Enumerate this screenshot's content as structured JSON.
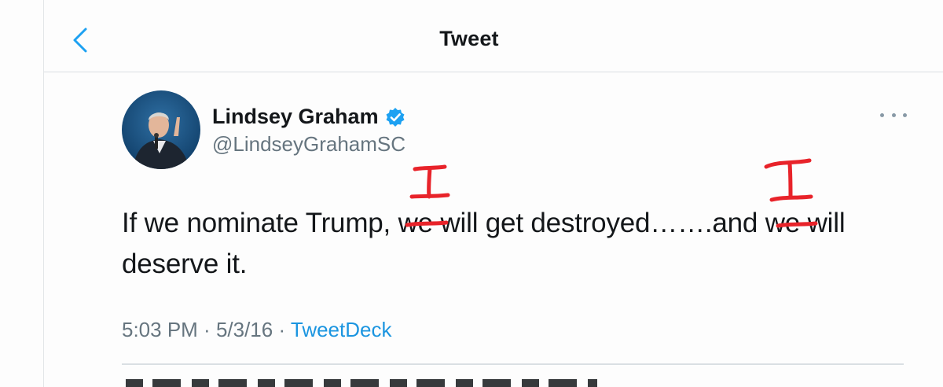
{
  "header": {
    "title": "Tweet",
    "back_icon": "chevron-left-icon"
  },
  "tweet": {
    "author_name": "Lindsey Graham",
    "verified_icon": "verified-badge-icon",
    "handle": "@LindseyGrahamSC",
    "more_icon": "more-horizontal-icon",
    "text_parts": {
      "p1": "If we nominate Trump, ",
      "struck1": "we",
      "p2": " will get destroyed…….and ",
      "struck2": "we",
      "p3": " will deserve it."
    },
    "time": "5:03 PM",
    "separator": " · ",
    "date": "5/3/16",
    "separator2": " · ",
    "source": "TweetDeck"
  },
  "annotations": {
    "replacement_1": "I",
    "replacement_2": "I",
    "ink_color": "#e8232a"
  },
  "colors": {
    "accent": "#1da1f2",
    "text": "#14171a",
    "muted": "#66757f"
  }
}
